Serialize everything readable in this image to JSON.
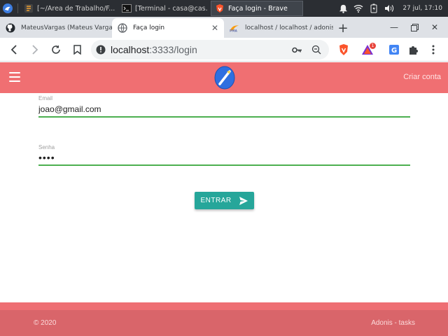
{
  "taskbar": {
    "tasks": [
      {
        "label": "[~/Área de Trabalho/F..."
      },
      {
        "label": "[Terminal - casa@cas..."
      },
      {
        "label": "Faça login - Brave"
      }
    ],
    "clock": "27 jul, 17:10"
  },
  "browser": {
    "tabs": [
      {
        "label": "MateusVargas (Mateus Vargas)"
      },
      {
        "label": "Faça login"
      },
      {
        "label": "localhost / localhost / adonis"
      }
    ],
    "url_host": "localhost",
    "url_port_path": ":3333/login",
    "extension_badge": "1"
  },
  "app": {
    "header": {
      "create_account": "Criar conta"
    },
    "form": {
      "email_label": "Email",
      "email_value": "joao@gmail.com",
      "password_label": "Senha",
      "password_value": "1234",
      "submit_label": "ENTRAR"
    },
    "footer": {
      "copyright": "© 2020",
      "brand": "Adonis - tasks"
    }
  },
  "colors": {
    "header": "#f06f72",
    "button": "#26a69a",
    "input_underline": "#4caf50",
    "footer": "#ee6e73"
  }
}
